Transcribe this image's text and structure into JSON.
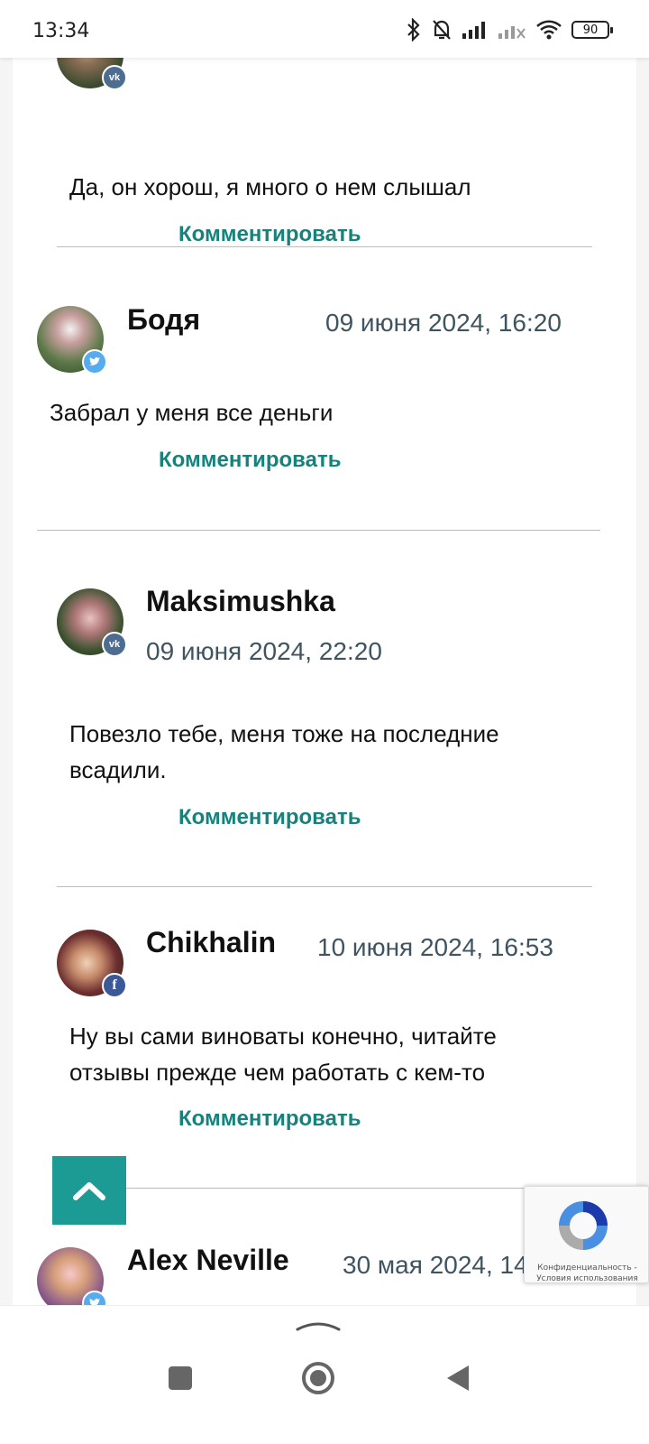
{
  "status": {
    "time": "13:34",
    "battery": "90"
  },
  "comments": [
    {
      "text": "Да, он хорош, я много о нем слышал",
      "reply_label": "Комментировать",
      "network": "vk"
    },
    {
      "author": "Бодя",
      "date": "09 июня 2024, 16:20",
      "text": "Забрал у меня все деньги",
      "reply_label": "Комментировать",
      "network": "twitter"
    },
    {
      "author": "Maksimushka",
      "date": "09 июня 2024, 22:20",
      "text_line1": "Повезло тебе, меня тоже на последние",
      "text_line2": "всадили.",
      "reply_label": "Комментировать",
      "network": "vk"
    },
    {
      "author": "Chikhalin",
      "date": "10 июня 2024, 16:53",
      "text_line1": "Ну вы сами виноваты конечно, читайте",
      "text_line2": "отзывы прежде чем работать с кем-то",
      "reply_label": "Комментировать",
      "network": "facebook"
    },
    {
      "author": "Alex Neville",
      "date": "30 мая 2024, 14",
      "network": "twitter"
    }
  ],
  "recaptcha": {
    "privacy": "Конфиденциальность",
    "separator": " - ",
    "terms": "Условия использования"
  },
  "icons": {
    "bluetooth": "bluetooth-icon",
    "mute": "bell-off-icon",
    "signal": "signal-icon",
    "wifi": "wifi-icon",
    "to_top": "chevron-up-icon",
    "vk": "vk-icon",
    "twitter": "twitter-icon",
    "facebook": "facebook-icon"
  },
  "colors": {
    "accent": "#1b9b94",
    "link": "#17827b",
    "date": "#3f5461"
  }
}
